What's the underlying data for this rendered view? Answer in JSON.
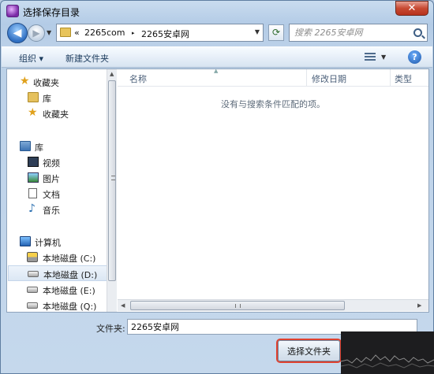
{
  "window": {
    "title": "选择保存目录",
    "close_glyph": "✕",
    "ghost_tabs": [
      "",
      "",
      "",
      "",
      ""
    ]
  },
  "nav": {
    "back_glyph": "◀",
    "fwd_glyph": "▶",
    "history_glyph": "▼",
    "address": {
      "prefix": "«",
      "segments": [
        "2265com",
        "2265安卓网"
      ],
      "separator": "▸",
      "dropdown_glyph": "▼"
    },
    "refresh_glyph": "⟳",
    "search_placeholder": "搜索 2265安卓网"
  },
  "toolbar": {
    "organize_label": "组织 ▾",
    "new_folder_label": "新建文件夹",
    "view_dropdown_glyph": "▼",
    "help_glyph": "?"
  },
  "sidebar": {
    "items": [
      {
        "label": "收藏夹",
        "icon": "star-icon"
      },
      {
        "label": "库",
        "icon": "folder-icon"
      },
      {
        "label": "收藏夹",
        "icon": "star-icon"
      },
      {
        "label": "库",
        "icon": "library-icon"
      },
      {
        "label": "视频",
        "icon": "video-icon"
      },
      {
        "label": "图片",
        "icon": "pictures-icon"
      },
      {
        "label": "文档",
        "icon": "documents-icon"
      },
      {
        "label": "音乐",
        "icon": "music-icon"
      },
      {
        "label": "计算机",
        "icon": "computer-icon"
      },
      {
        "label": "本地磁盘 (C:)",
        "icon": "system-drive-icon"
      },
      {
        "label": "本地磁盘 (D:)",
        "icon": "drive-icon",
        "selected": true
      },
      {
        "label": "本地磁盘 (E:)",
        "icon": "drive-icon"
      },
      {
        "label": "本地磁盘 (Q:)",
        "icon": "drive-icon"
      }
    ]
  },
  "content": {
    "columns": [
      "名称",
      "修改日期",
      "类型"
    ],
    "empty_message": "没有与搜索条件匹配的项。"
  },
  "footer": {
    "filename_label": "文件夹:",
    "filename_value": "2265安卓网",
    "select_button": "选择文件夹"
  },
  "colors": {
    "highlight": "#e0412f",
    "accent": "#3d74b3"
  }
}
